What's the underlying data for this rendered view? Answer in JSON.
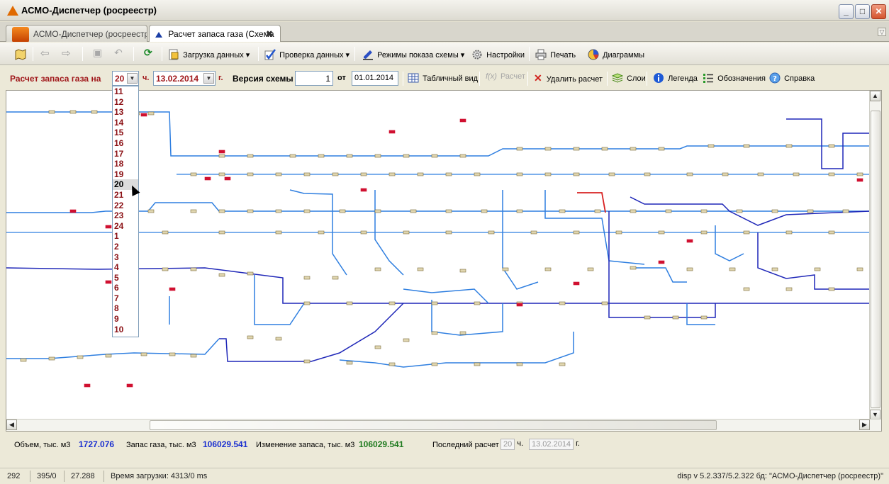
{
  "window": {
    "title": "АСМО-Диспетчер (росреестр)",
    "minimize": "_",
    "maximize": "□",
    "close": "✕"
  },
  "tabs": [
    {
      "label": "АСМО-Диспетчер (росреестр)"
    },
    {
      "label": "Расчет запаса газа (Схема",
      "close": "✖"
    }
  ],
  "tab_scroll": "▽",
  "toolbar": {
    "back": "⇦",
    "forward": "⇨",
    "save": "▣",
    "undo": "↶",
    "refresh": "⟳",
    "load_data": "Загрузка данных ▾",
    "check_data": "Проверка данных ▾",
    "display_modes": "Режимы показа схемы ▾",
    "settings": "Настройки",
    "print": "Печать",
    "diagrams": "Диаграммы"
  },
  "params": {
    "calc_label": "Расчет запаса газа на",
    "hour_value": "20",
    "hour_unit": "ч.",
    "date_value": "13.02.2014",
    "date_unit": "г.",
    "version_label": "Версия схемы",
    "version_value": "1",
    "from_label": "от",
    "from_date": "01.01.2014",
    "table_view": "Табличный вид",
    "calc_button": "Расчет",
    "delete_calc": "Удалить расчет",
    "layers": "Слои",
    "legend": "Легенда",
    "designations": "Обозначения",
    "help": "Справка"
  },
  "hour_options": [
    "11",
    "12",
    "13",
    "14",
    "15",
    "16",
    "17",
    "18",
    "19",
    "20",
    "21",
    "22",
    "23",
    "24",
    "1",
    "2",
    "3",
    "4",
    "5",
    "6",
    "7",
    "8",
    "9",
    "10"
  ],
  "hour_selected_index": 9,
  "status_line": {
    "volume_label": "Объем, тыс. м3",
    "volume_value": "1727.076",
    "stock_label": "Запас газа, тыс. м3",
    "stock_value": "106029.541",
    "change_label": "Изменение запаса, тыс. м3",
    "change_value": "106029.541",
    "last_calc_label": "Последний расчет",
    "last_hour": "20",
    "last_hour_unit": "ч.",
    "last_date": "13.02.2014",
    "last_date_unit": "г."
  },
  "status_bar": {
    "f1": "292",
    "f2": "395/0",
    "f3": "27.288",
    "load_time": "Время загрузки: 4313/0 ms",
    "version": "disp  v 5.2.337/5.2.322  бд: \"АСМО-Диспетчер (росреестр)\""
  },
  "colors": {
    "pipe_light": "#2f7fe0",
    "pipe_dark": "#1f27b8",
    "pipe_red": "#d82020",
    "node_green": "#1e9a2e",
    "node_red": "#d01030",
    "label_red": "#a0171a",
    "value_blue": "#1a2fd0",
    "value_green": "#1e7a1e"
  }
}
